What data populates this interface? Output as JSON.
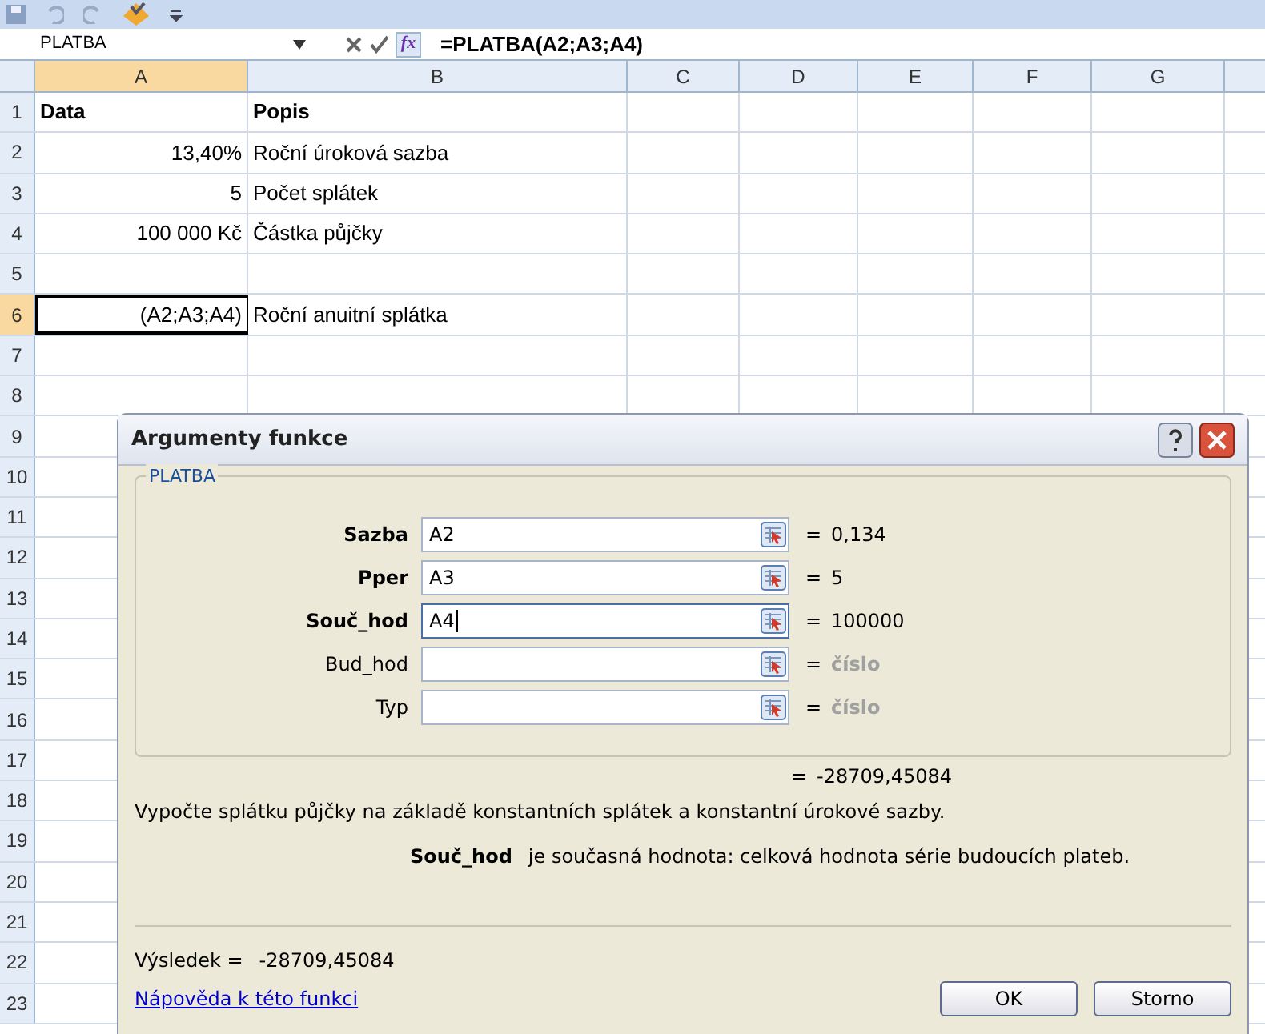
{
  "formula_bar": {
    "name_box": "PLATBA",
    "formula": "=PLATBA(A2;A3;A4)",
    "function_button": "fx"
  },
  "sheet": {
    "columns": [
      {
        "label": "A",
        "selected": true
      },
      {
        "label": "B",
        "selected": false
      },
      {
        "label": "C",
        "selected": false
      },
      {
        "label": "D",
        "selected": false
      },
      {
        "label": "E",
        "selected": false
      },
      {
        "label": "F",
        "selected": false
      },
      {
        "label": "G",
        "selected": false
      }
    ],
    "rows": [
      {
        "label": "1",
        "selected": false,
        "cells": [
          {
            "text": "Data",
            "bold": true,
            "kind": "text"
          },
          {
            "text": "Popis",
            "bold": true,
            "kind": "text"
          }
        ]
      },
      {
        "label": "2",
        "selected": false,
        "cells": [
          {
            "text": "13,40%",
            "bold": false,
            "kind": "number"
          },
          {
            "text": "Roční úroková sazba",
            "bold": false,
            "kind": "text"
          }
        ]
      },
      {
        "label": "3",
        "selected": false,
        "cells": [
          {
            "text": "5",
            "bold": false,
            "kind": "number"
          },
          {
            "text": "Počet splátek",
            "bold": false,
            "kind": "text"
          }
        ]
      },
      {
        "label": "4",
        "selected": false,
        "cells": [
          {
            "text": "100 000 Kč",
            "bold": false,
            "kind": "number"
          },
          {
            "text": "Částka půjčky",
            "bold": false,
            "kind": "text"
          }
        ]
      },
      {
        "label": "5",
        "selected": false,
        "cells": []
      },
      {
        "label": "6",
        "selected": true,
        "cells": [
          {
            "text": "(A2;A3;A4)",
            "bold": false,
            "kind": "number",
            "selected": true
          },
          {
            "text": "Roční anuitní splátka",
            "bold": false,
            "kind": "text"
          }
        ]
      },
      {
        "label": "7",
        "selected": false,
        "cells": []
      },
      {
        "label": "8",
        "selected": false,
        "cells": []
      },
      {
        "label": "9",
        "selected": false,
        "cells": []
      },
      {
        "label": "10",
        "selected": false,
        "cells": []
      },
      {
        "label": "11",
        "selected": false,
        "cells": []
      },
      {
        "label": "12",
        "selected": false,
        "cells": []
      },
      {
        "label": "13",
        "selected": false,
        "cells": []
      },
      {
        "label": "14",
        "selected": false,
        "cells": []
      },
      {
        "label": "15",
        "selected": false,
        "cells": []
      },
      {
        "label": "16",
        "selected": false,
        "cells": []
      },
      {
        "label": "17",
        "selected": false,
        "cells": []
      },
      {
        "label": "18",
        "selected": false,
        "cells": []
      },
      {
        "label": "19",
        "selected": false,
        "cells": []
      },
      {
        "label": "20",
        "selected": false,
        "cells": []
      },
      {
        "label": "21",
        "selected": false,
        "cells": []
      },
      {
        "label": "22",
        "selected": false,
        "cells": []
      },
      {
        "label": "23",
        "selected": false,
        "cells": []
      }
    ]
  },
  "dialog": {
    "title": "Argumenty funkce",
    "group": "PLATBA",
    "arguments": [
      {
        "label": "Sazba",
        "required": true,
        "value": "A2",
        "focused": false,
        "result": "0,134",
        "result_muted": false
      },
      {
        "label": "Pper",
        "required": true,
        "value": "A3",
        "focused": false,
        "result": "5",
        "result_muted": false
      },
      {
        "label": "Souč_hod",
        "required": true,
        "value": "A4",
        "focused": true,
        "result": "100000",
        "result_muted": false
      },
      {
        "label": "Bud_hod",
        "required": false,
        "focused": false,
        "result": "číslo",
        "result_muted": true
      },
      {
        "label": "Typ",
        "required": false,
        "focused": false,
        "result": "číslo",
        "result_muted": true
      }
    ],
    "equals": "=",
    "function_result": "-28709,45084",
    "description": "Vypočte splátku půjčky na základě konstantních splátek a konstantní úrokové sazby.",
    "argument_help_name": "Souč_hod",
    "argument_help": "je současná hodnota: celková hodnota série budoucích plateb.",
    "result_label": "Výsledek =",
    "result_value": "-28709,45084",
    "help_link": "Nápověda k této funkci",
    "buttons": [
      "OK",
      "Storno"
    ]
  }
}
